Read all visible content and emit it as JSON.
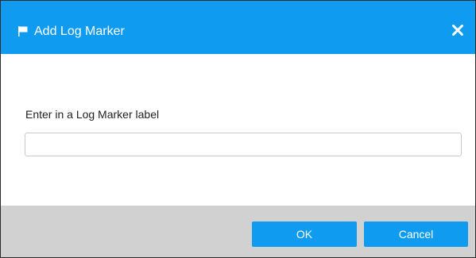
{
  "dialog": {
    "title": "Add Log Marker",
    "title_icon": "flag-icon",
    "close_icon": "close-icon"
  },
  "form": {
    "label": "Enter in a Log Marker label",
    "input_value": "",
    "input_placeholder": ""
  },
  "footer": {
    "ok_label": "OK",
    "cancel_label": "Cancel"
  },
  "colors": {
    "accent": "#0f9bf0",
    "footer_background": "#d1d1d1",
    "title_text": "#ffffff"
  }
}
